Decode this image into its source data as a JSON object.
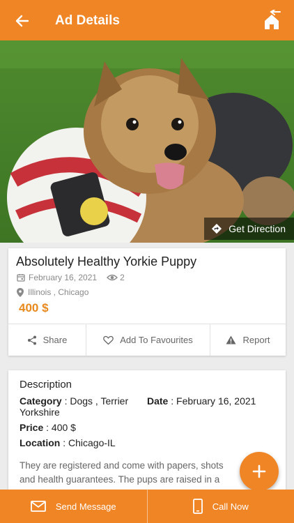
{
  "header": {
    "title": "Ad Details",
    "back_icon": "back-arrow-icon",
    "home_icon": "home-icon"
  },
  "photo": {
    "subject": "yorkie-puppy-photo",
    "get_direction_label": "Get Direction"
  },
  "ad": {
    "title": "Absolutely Healthy Yorkie Puppy",
    "date": "February 16, 2021",
    "views": "2",
    "location": "Illinois , Chicago",
    "price": "400 $"
  },
  "actions": {
    "share": "Share",
    "favourites": "Add To Favourites",
    "report": "Report"
  },
  "description": {
    "heading": "Description",
    "category_label": "Category",
    "category_value": ": Dogs , Terrier Yorkshire",
    "date_label": "Date",
    "date_value": ": February 16, 2021",
    "price_label": "Price",
    "price_value": ": 400 $",
    "location_label": "Location",
    "location_value": ": Chicago-IL",
    "text": "They are registered and come with papers, shots and health guarantees. The pups are raised in a loving"
  },
  "bottom_bar": {
    "send_message": "Send Message",
    "call_now": "Call Now"
  },
  "colors": {
    "accent": "#f08526",
    "price": "#e8891c",
    "muted": "#8a8a8a"
  }
}
